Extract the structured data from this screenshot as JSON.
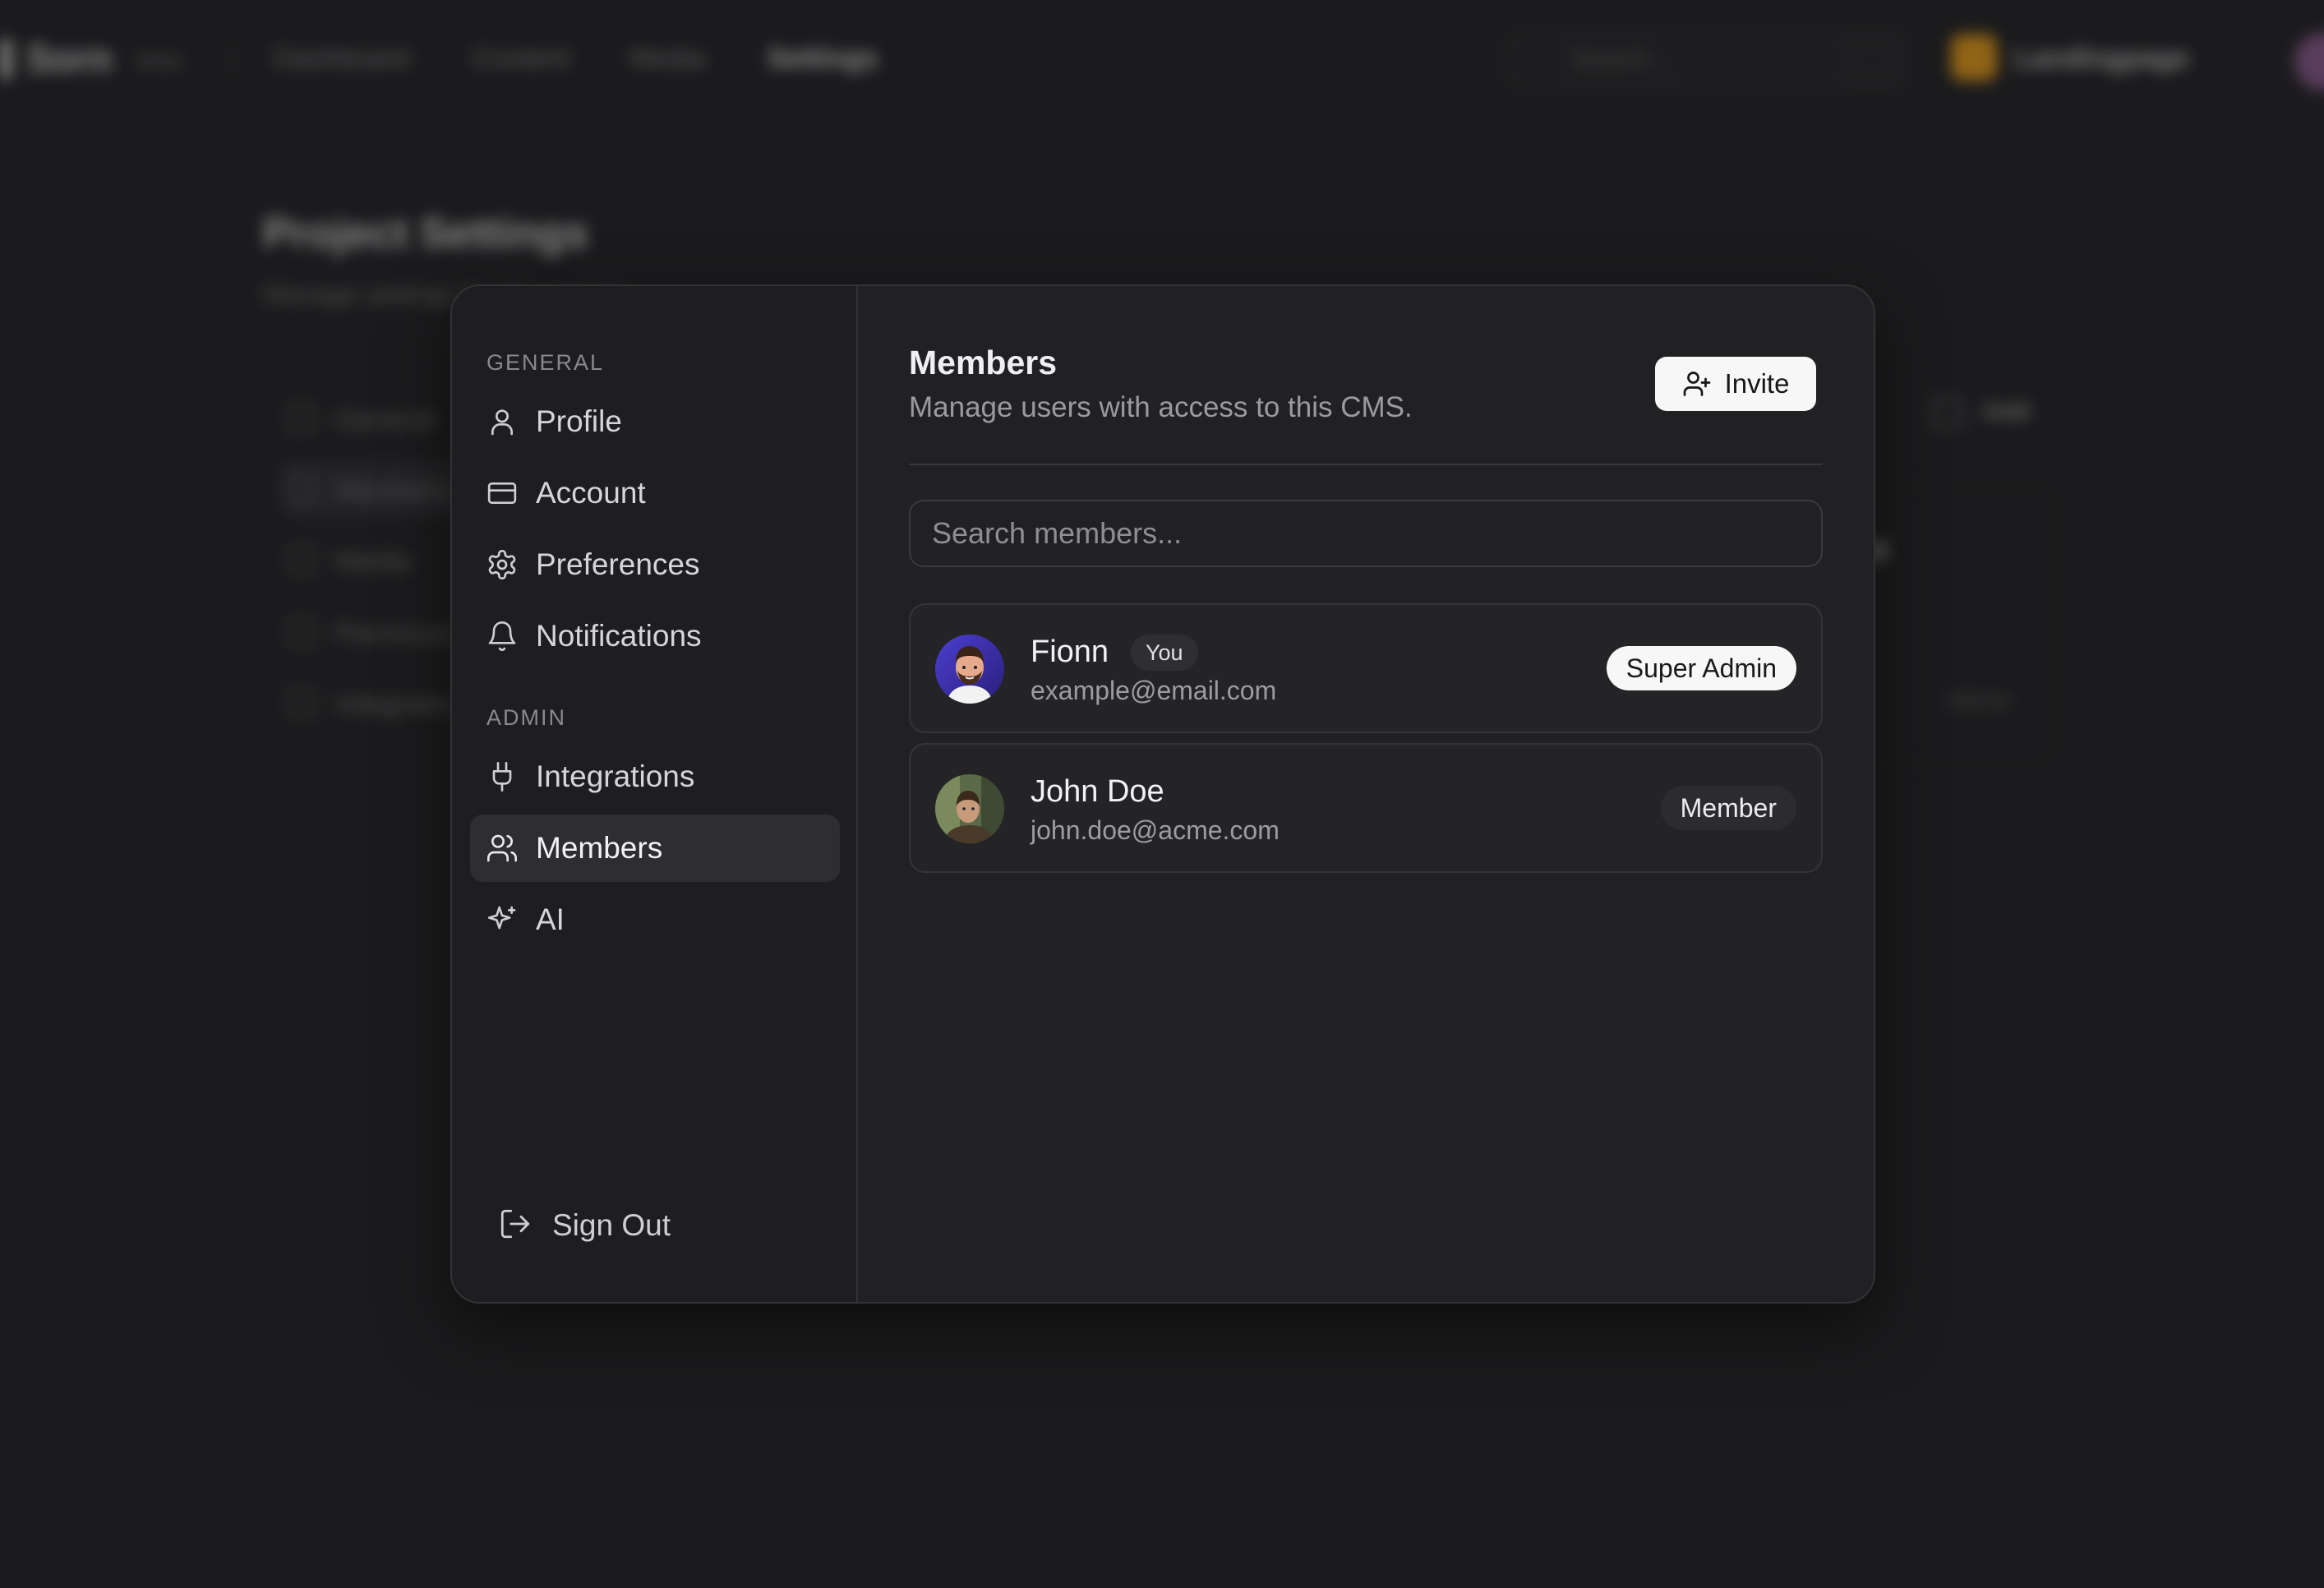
{
  "background": {
    "brand": "Sorn",
    "brand_sub": "beta",
    "nav": [
      "Dashboard",
      "Content",
      "Media",
      "Settings"
    ],
    "search_placeholder": "Search...",
    "org_name": "Landingpage",
    "page_title": "Project Settings",
    "page_subtitle": "Manage settings for this project",
    "side_items": [
      "General",
      "Members",
      "Media",
      "Permissions",
      "Integrations"
    ],
    "add_label": "Add",
    "mini_label": "Admin"
  },
  "modal": {
    "sidebar": {
      "general_label": "GENERAL",
      "admin_label": "ADMIN",
      "items": [
        {
          "label": "Profile",
          "icon": "user-icon"
        },
        {
          "label": "Account",
          "icon": "credit-card-icon"
        },
        {
          "label": "Preferences",
          "icon": "gear-icon"
        },
        {
          "label": "Notifications",
          "icon": "bell-icon"
        },
        {
          "label": "Integrations",
          "icon": "plug-icon"
        },
        {
          "label": "Members",
          "icon": "users-icon",
          "active": true
        },
        {
          "label": "AI",
          "icon": "sparkles-icon"
        }
      ],
      "sign_out": "Sign Out"
    },
    "content": {
      "title": "Members",
      "subtitle": "Manage users with access to this CMS.",
      "invite_label": "Invite",
      "search_placeholder": "Search members...",
      "members": [
        {
          "name": "Fionn",
          "badge": "You",
          "email": "example@email.com",
          "role": "Super Admin"
        },
        {
          "name": "John Doe",
          "badge": "",
          "email": "john.doe@acme.com",
          "role": "Member"
        }
      ]
    }
  },
  "colors": {
    "background": "#1b1b1d",
    "modal": "#212123",
    "sidebar": "#1e1e20",
    "active_item": "#2e2e31",
    "primary_button": "#f7f7f8",
    "org_avatar": "#f2a111"
  }
}
